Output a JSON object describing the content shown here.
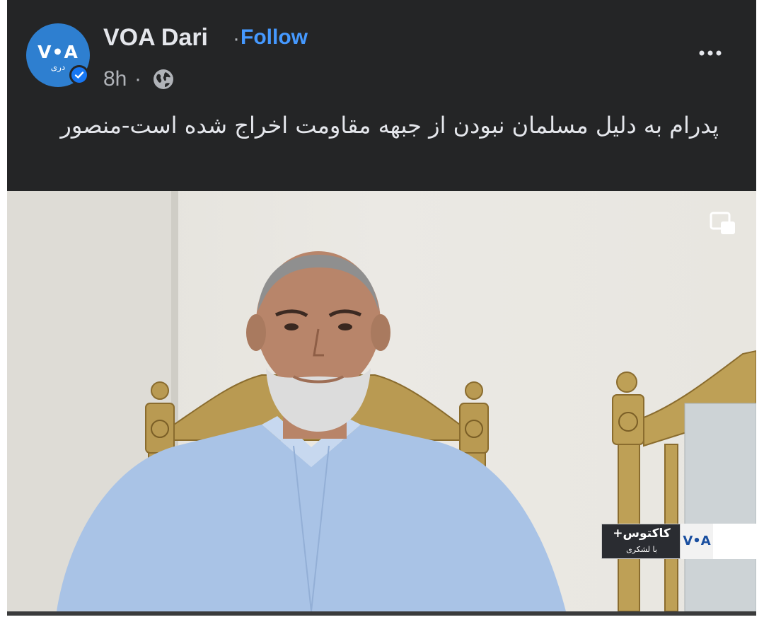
{
  "post": {
    "page_name": "VOA Dari",
    "separator": "·",
    "follow_label": "Follow",
    "time": "8h",
    "time_separator": "·",
    "audience_icon": "globe-icon",
    "more_icon": "more-options-icon",
    "text": "پدرام به دلیل مسلمان نبودن از جبهه مقاومت اخراج شده است-منصور"
  },
  "avatar": {
    "logo_text": "V•A",
    "sub_text": "دری",
    "color": "#2e7fd0",
    "verified_color": "#1877f2"
  },
  "video": {
    "pip_icon": "picture-in-picture-icon",
    "lower_third": {
      "show_title": "کاکتوس+",
      "show_subtitle": "با لشکری",
      "logo_text": "V•A"
    }
  },
  "colors": {
    "background": "#242526",
    "text_primary": "#e4e6eb",
    "text_secondary": "#b0b3b8",
    "link": "#4599ff"
  }
}
